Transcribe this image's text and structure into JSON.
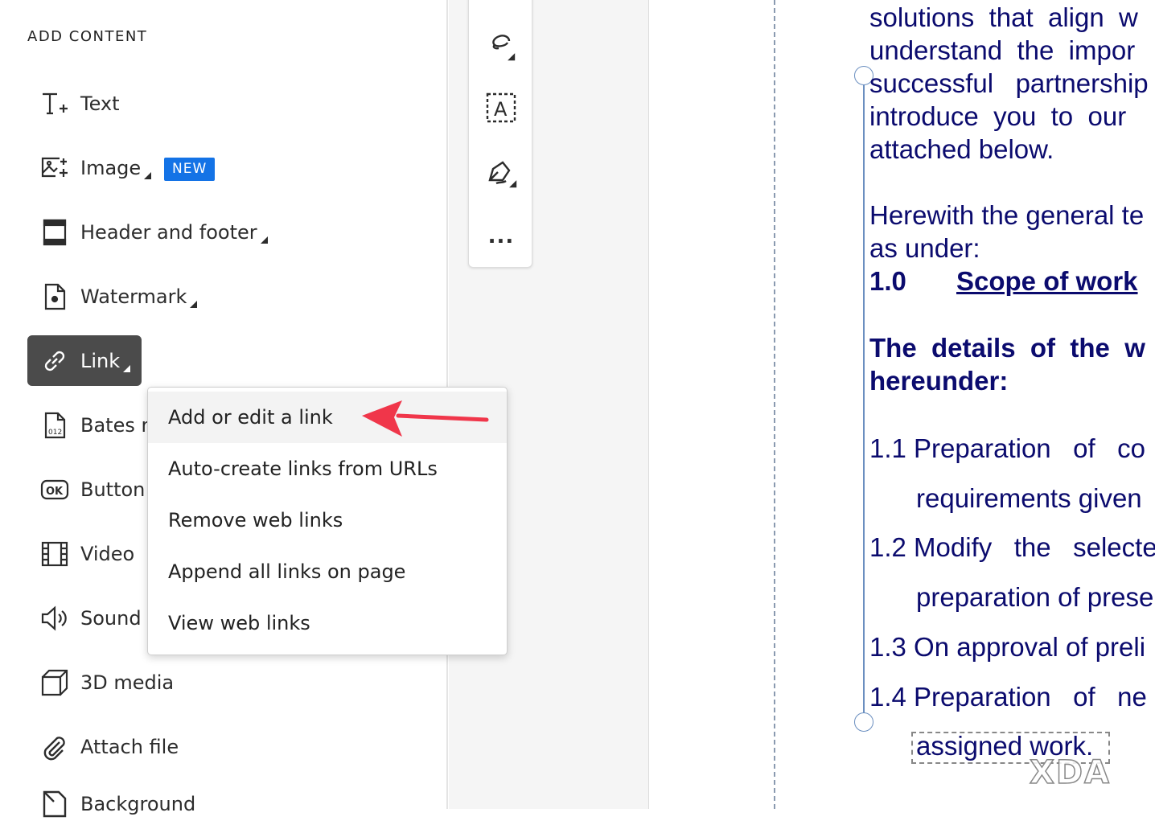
{
  "sidebar": {
    "heading": "ADD CONTENT",
    "new_badge": "NEW",
    "items": [
      {
        "label": "Text",
        "icon": "text-add-icon"
      },
      {
        "label": "Image",
        "icon": "image-add-icon"
      },
      {
        "label": "Header and footer",
        "icon": "header-footer-icon"
      },
      {
        "label": "Watermark",
        "icon": "watermark-icon"
      },
      {
        "label": "Link",
        "icon": "link-icon",
        "selected": true
      },
      {
        "label": "Bates n",
        "icon": "bates-numbering-icon"
      },
      {
        "label": "Button",
        "icon": "ok-button-icon"
      },
      {
        "label": "Video",
        "icon": "video-icon"
      },
      {
        "label": "Sound",
        "icon": "sound-icon"
      },
      {
        "label": "3D media",
        "icon": "cube-icon"
      },
      {
        "label": "Attach file",
        "icon": "paperclip-icon"
      },
      {
        "label": "Background",
        "icon": "background-icon"
      }
    ]
  },
  "toolbar": {
    "tools": [
      "lasso-icon",
      "text-field-icon",
      "signature-pen-icon",
      "more-icon"
    ],
    "more_label": "..."
  },
  "link_menu": {
    "items": [
      "Add or edit a link",
      "Auto-create links from URLs",
      "Remove web links",
      "Append all links on page",
      "View web links"
    ],
    "highlighted": 0,
    "arrow_color": "#f0364a"
  },
  "document": {
    "lines": [
      "solutions  that  align  w",
      "understand  the  impor",
      "successful   partnership",
      "introduce  you  to  our",
      "attached below.",
      "Herewith the general te",
      "as under:",
      "1.0",
      "Scope of work",
      "The  details  of  the  w",
      "hereunder:",
      "1.1 Preparation   of   co",
      "requirements given",
      "1.2 Modify   the   selecte",
      "preparation of prese",
      "1.3 On approval of preli",
      "1.4 Preparation   of   ne",
      "assigned work."
    ],
    "text_color": "#0b0b6e"
  },
  "watermark": "XDA"
}
